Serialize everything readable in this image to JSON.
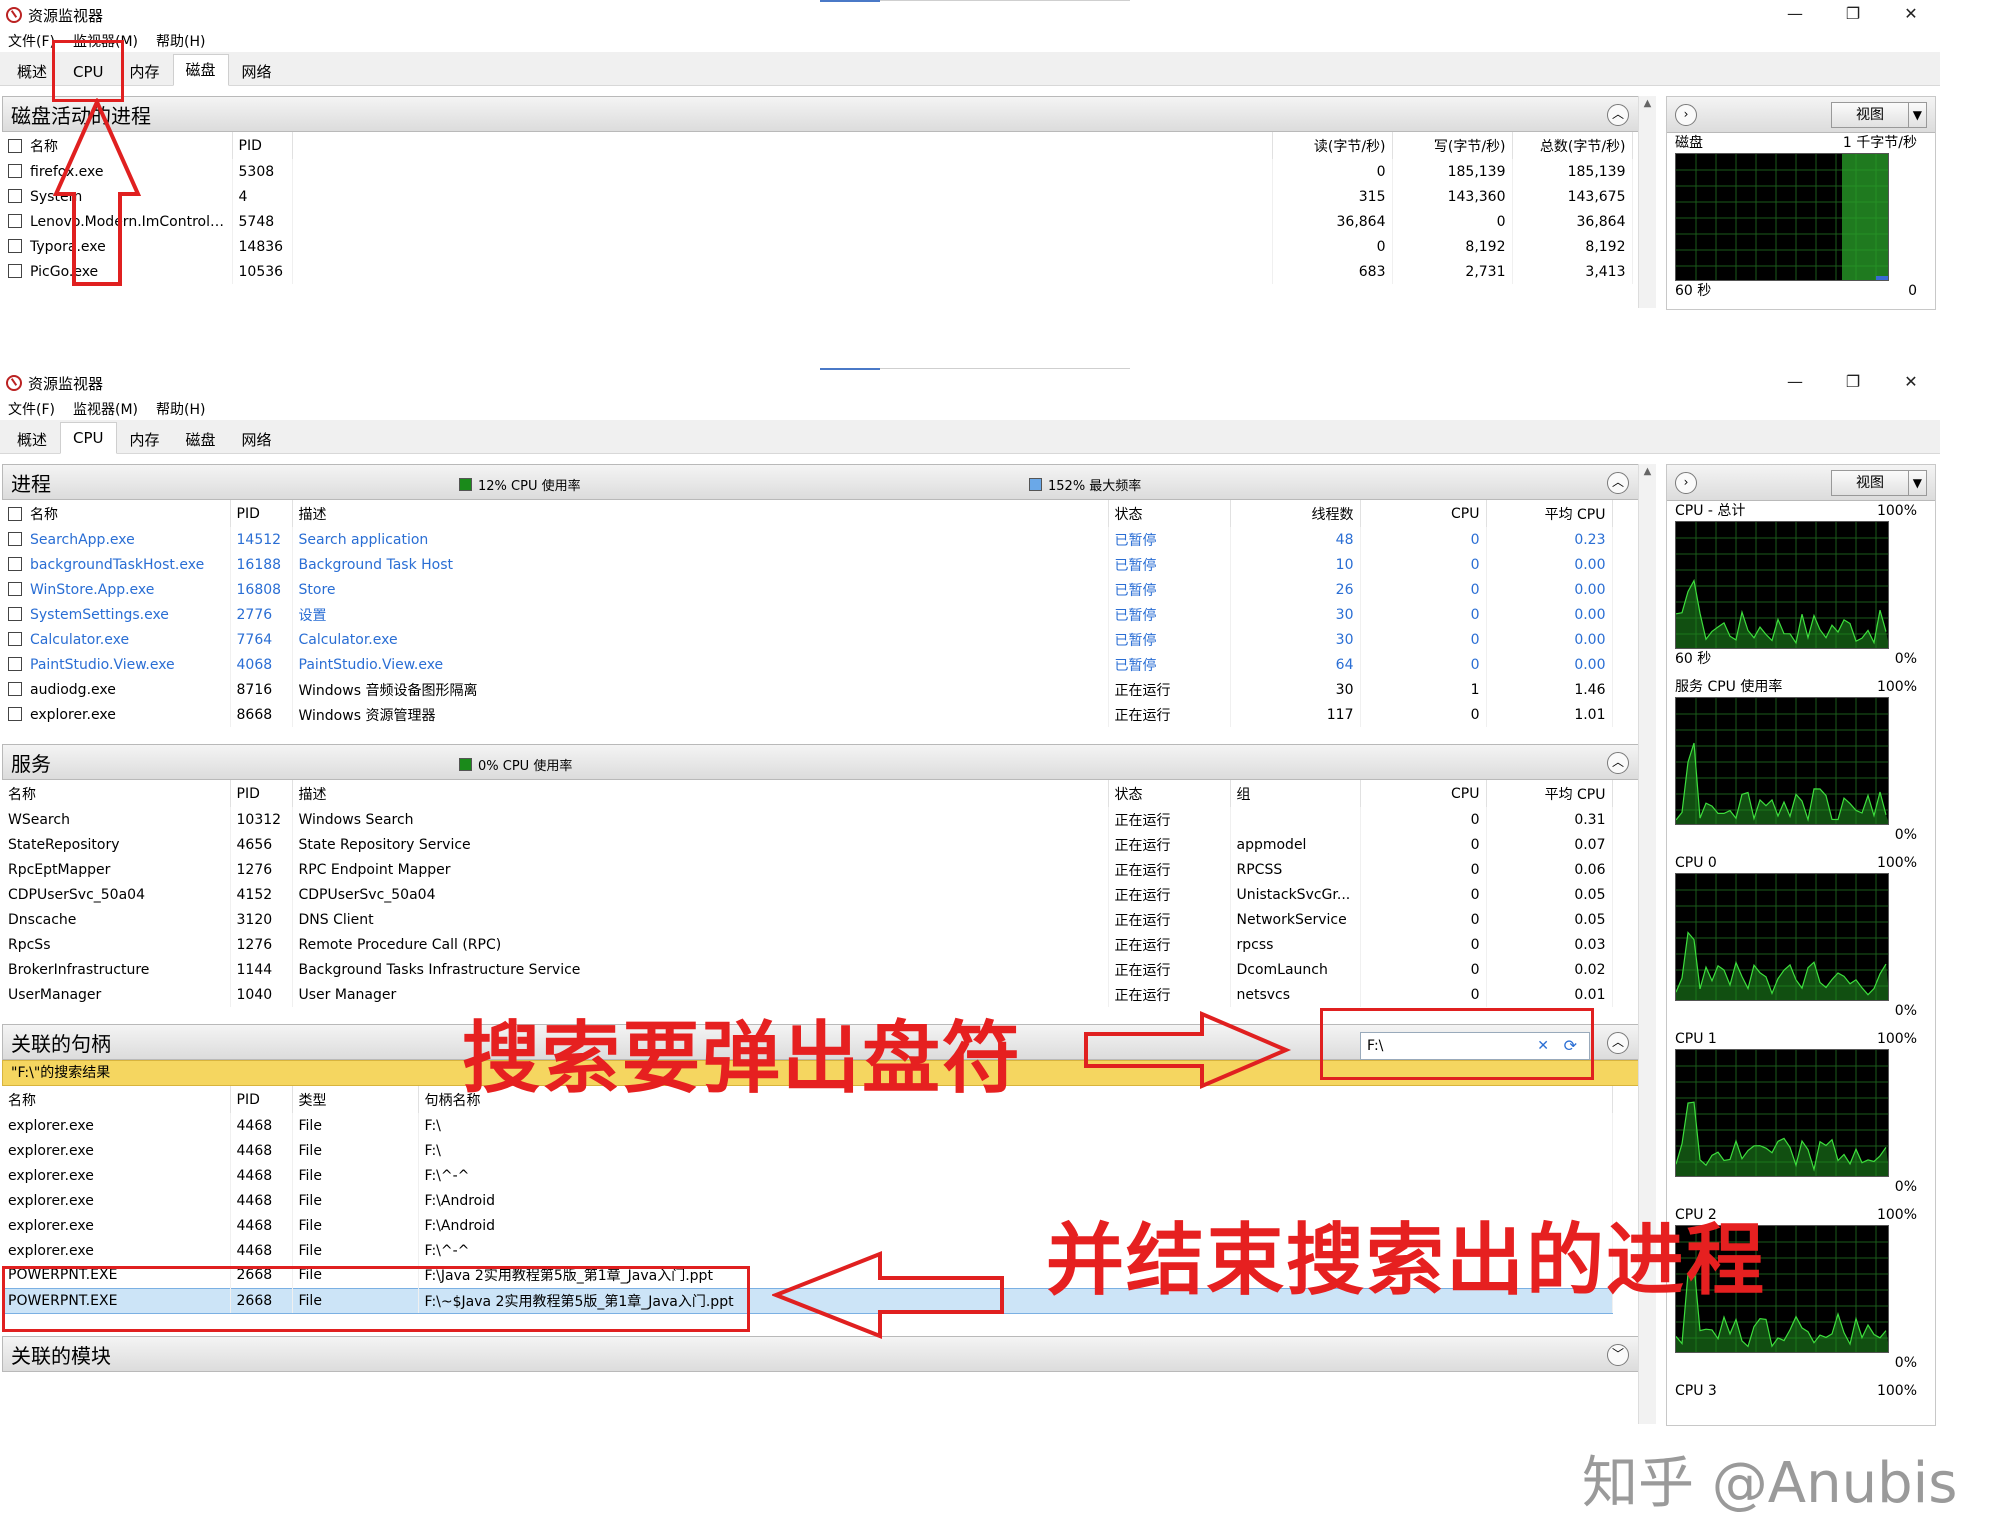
{
  "window": {
    "title": "资源监视器",
    "menu": [
      "文件(F)",
      "监视器(M)",
      "帮助(H)"
    ],
    "tabs": [
      "概述",
      "CPU",
      "内存",
      "磁盘",
      "网络"
    ],
    "controls": [
      "—",
      "❐",
      "✕"
    ]
  },
  "top_window": {
    "active_tab": "磁盘",
    "section_title": "磁盘活动的进程",
    "columns": [
      "名称",
      "PID",
      "读(字节/秒)",
      "写(字节/秒)",
      "总数(字节/秒)"
    ],
    "rows": [
      [
        "firefox.exe",
        "5308",
        "0",
        "185,139",
        "185,139"
      ],
      [
        "System",
        "4",
        "315",
        "143,360",
        "143,675"
      ],
      [
        "Lenovo.Modern.ImController...",
        "5748",
        "36,864",
        "0",
        "36,864"
      ],
      [
        "Typora.exe",
        "14836",
        "0",
        "8,192",
        "8,192"
      ],
      [
        "PicGo.exe",
        "10536",
        "683",
        "2,731",
        "3,413"
      ]
    ],
    "side_panel": {
      "view_button": "视图",
      "graph_label": "磁盘",
      "graph_scale": "1 千字节/秒",
      "graph_time": "60 秒",
      "graph_min": "0"
    }
  },
  "bottom_window": {
    "active_tab": "CPU",
    "process": {
      "title": "进程",
      "legend_usage": "12% CPU 使用率",
      "legend_freq": "152% 最大频率",
      "columns": [
        "名称",
        "PID",
        "描述",
        "状态",
        "线程数",
        "CPU",
        "平均 CPU"
      ],
      "rows": [
        {
          "cells": [
            "SearchApp.exe",
            "14512",
            "Search application",
            "已暂停",
            "48",
            "0",
            "0.23"
          ],
          "suspended": true
        },
        {
          "cells": [
            "backgroundTaskHost.exe",
            "16188",
            "Background Task Host",
            "已暂停",
            "10",
            "0",
            "0.00"
          ],
          "suspended": true
        },
        {
          "cells": [
            "WinStore.App.exe",
            "16808",
            "Store",
            "已暂停",
            "26",
            "0",
            "0.00"
          ],
          "suspended": true
        },
        {
          "cells": [
            "SystemSettings.exe",
            "2776",
            "设置",
            "已暂停",
            "30",
            "0",
            "0.00"
          ],
          "suspended": true
        },
        {
          "cells": [
            "Calculator.exe",
            "7764",
            "Calculator.exe",
            "已暂停",
            "30",
            "0",
            "0.00"
          ],
          "suspended": true
        },
        {
          "cells": [
            "PaintStudio.View.exe",
            "4068",
            "PaintStudio.View.exe",
            "已暂停",
            "64",
            "0",
            "0.00"
          ],
          "suspended": true
        },
        {
          "cells": [
            "audiodg.exe",
            "8716",
            "Windows 音频设备图形隔离",
            "正在运行",
            "30",
            "1",
            "1.46"
          ],
          "suspended": false
        },
        {
          "cells": [
            "explorer.exe",
            "8668",
            "Windows 资源管理器",
            "正在运行",
            "117",
            "0",
            "1.01"
          ],
          "suspended": false
        }
      ]
    },
    "services": {
      "title": "服务",
      "legend_usage": "0% CPU 使用率",
      "columns": [
        "名称",
        "PID",
        "描述",
        "状态",
        "组",
        "CPU",
        "平均 CPU"
      ],
      "rows": [
        [
          "WSearch",
          "10312",
          "Windows Search",
          "正在运行",
          "",
          "0",
          "0.31"
        ],
        [
          "StateRepository",
          "4656",
          "State Repository Service",
          "正在运行",
          "appmodel",
          "0",
          "0.07"
        ],
        [
          "RpcEptMapper",
          "1276",
          "RPC Endpoint Mapper",
          "正在运行",
          "RPCSS",
          "0",
          "0.06"
        ],
        [
          "CDPUserSvc_50a04",
          "4152",
          "CDPUserSvc_50a04",
          "正在运行",
          "UnistackSvcGr...",
          "0",
          "0.05"
        ],
        [
          "Dnscache",
          "3120",
          "DNS Client",
          "正在运行",
          "NetworkService",
          "0",
          "0.05"
        ],
        [
          "RpcSs",
          "1276",
          "Remote Procedure Call (RPC)",
          "正在运行",
          "rpcss",
          "0",
          "0.03"
        ],
        [
          "BrokerInfrastructure",
          "1144",
          "Background Tasks Infrastructure Service",
          "正在运行",
          "DcomLaunch",
          "0",
          "0.02"
        ],
        [
          "UserManager",
          "1040",
          "User Manager",
          "正在运行",
          "netsvcs",
          "0",
          "0.01"
        ]
      ]
    },
    "handles": {
      "title": "关联的句柄",
      "search_value": "F:\\",
      "result_label": "\"F:\\\"的搜索结果",
      "columns": [
        "名称",
        "PID",
        "类型",
        "句柄名称"
      ],
      "rows": [
        [
          "explorer.exe",
          "4468",
          "File",
          "F:\\"
        ],
        [
          "explorer.exe",
          "4468",
          "File",
          "F:\\"
        ],
        [
          "explorer.exe",
          "4468",
          "File",
          "F:\\^-^"
        ],
        [
          "explorer.exe",
          "4468",
          "File",
          "F:\\Android"
        ],
        [
          "explorer.exe",
          "4468",
          "File",
          "F:\\Android"
        ],
        [
          "explorer.exe",
          "4468",
          "File",
          "F:\\^-^"
        ],
        [
          "POWERPNT.EXE",
          "2668",
          "File",
          "F:\\Java 2实用教程第5版_第1章_Java入门.ppt"
        ],
        [
          "POWERPNT.EXE",
          "2668",
          "File",
          "F:\\~$Java 2实用教程第5版_第1章_Java入门.ppt"
        ]
      ]
    },
    "modules": {
      "title": "关联的模块"
    },
    "side_panel": {
      "view_button": "视图",
      "graphs": [
        {
          "label": "CPU - 总计",
          "max": "100%",
          "time": "60 秒",
          "min": "0%"
        },
        {
          "label": "服务 CPU 使用率",
          "max": "100%",
          "time": "",
          "min": "0%"
        },
        {
          "label": "CPU 0",
          "max": "100%",
          "time": "",
          "min": "0%"
        },
        {
          "label": "CPU 1",
          "max": "100%",
          "time": "",
          "min": "0%"
        },
        {
          "label": "CPU 2",
          "max": "100%",
          "time": "",
          "min": "0%"
        }
      ],
      "last_label": "CPU 3",
      "last_max": "100%"
    }
  },
  "annotations": {
    "search_hint": "搜索要弹出盘符",
    "kill_hint": "并结束搜索出的进程"
  },
  "watermark": "知乎 @Anubis"
}
